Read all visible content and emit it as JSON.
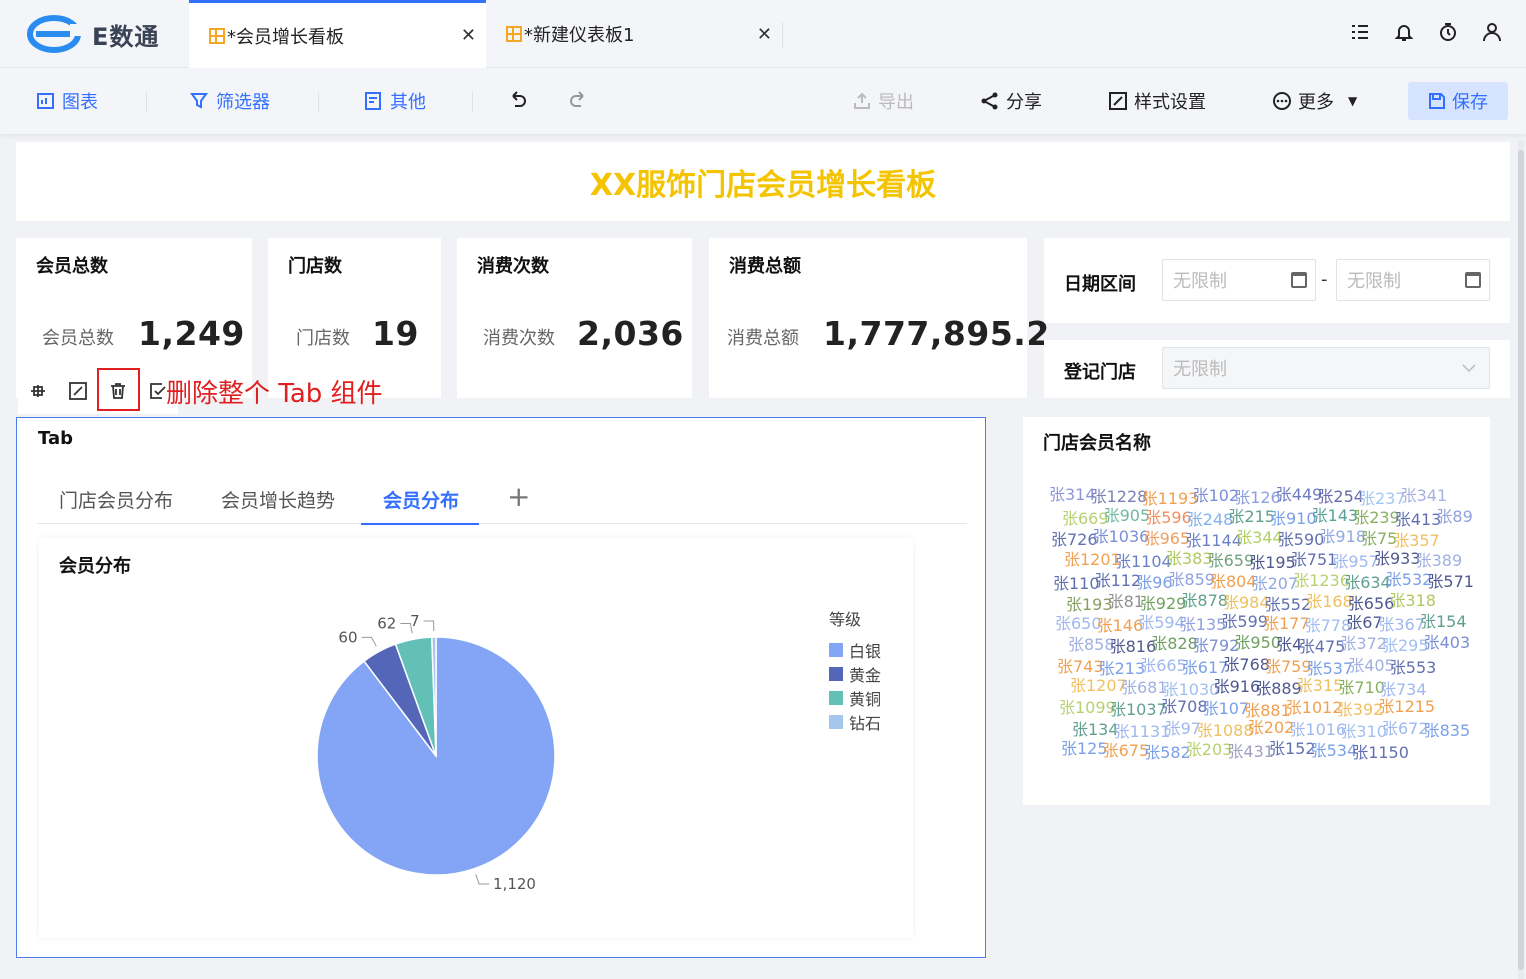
{
  "app": {
    "logo_text": "E数通"
  },
  "tabs": [
    {
      "label": "*会员增长看板",
      "active": true
    },
    {
      "label": "*新建仪表板1",
      "active": false
    }
  ],
  "toolbar": {
    "chart": "图表",
    "filter": "筛选器",
    "other": "其他",
    "export": "导出",
    "share": "分享",
    "style": "样式设置",
    "more": "更多",
    "save": "保存"
  },
  "dashboard_title": "XX服饰门店会员增长看板",
  "kpis": [
    {
      "title": "会员总数",
      "label": "会员总数",
      "value": "1,249"
    },
    {
      "title": "门店数",
      "label": "门店数",
      "value": "19"
    },
    {
      "title": "消费次数",
      "label": "消费次数",
      "value": "2,036"
    },
    {
      "title": "消费总额",
      "label": "消费总额",
      "value": "1,777,895.2"
    }
  ],
  "filters": {
    "date_label": "日期区间",
    "date_start_placeholder": "无限制",
    "date_sep": "-",
    "date_end_placeholder": "无限制",
    "store_label": "登记门店",
    "store_placeholder": "无限制"
  },
  "annotation": "删除整个 Tab 组件",
  "tab_component": {
    "title": "Tab",
    "tabs": [
      "门店会员分布",
      "会员增长趋势",
      "会员分布"
    ],
    "active_tab": "会员分布",
    "add": "+"
  },
  "chart_data": {
    "type": "pie",
    "title": "会员分布",
    "legend_title": "等级",
    "categories": [
      "白银",
      "黄金",
      "黄铜",
      "钻石"
    ],
    "values": [
      1120,
      60,
      62,
      7
    ],
    "labels": [
      "1,120",
      "60",
      "62",
      "7"
    ],
    "colors": [
      "#84a5f6",
      "#5466b8",
      "#62c0b6",
      "#a4c6ea"
    ]
  },
  "word_cloud": {
    "title": "门店会员名称",
    "words": [
      [
        "张314",
        "#8f97d8"
      ],
      [
        "张1228",
        "#7a7fb8"
      ],
      [
        "张1193",
        "#f0a050"
      ],
      [
        "张102",
        "#7a8fd6"
      ],
      [
        "张126",
        "#8ca0e0"
      ],
      [
        "张449",
        "#6b7cc4"
      ],
      [
        "张254",
        "#6a6ab0"
      ],
      [
        "张237",
        "#a0c8f0"
      ],
      [
        "张341",
        "#a4b0e0"
      ],
      [
        "张669",
        "#b8d070"
      ],
      [
        "张905",
        "#70b8a0"
      ],
      [
        "张596",
        "#f09060"
      ],
      [
        "张248",
        "#7fb0f0"
      ],
      [
        "张215",
        "#60a090"
      ],
      [
        "张910",
        "#7aa0e8"
      ],
      [
        "张143",
        "#5aa098"
      ],
      [
        "张239",
        "#88b060"
      ],
      [
        "张413",
        "#6070b0"
      ],
      [
        "张89",
        "#90a0e0"
      ],
      [
        "张726",
        "#6070b0"
      ],
      [
        "张1036",
        "#7a8fd6"
      ],
      [
        "张965",
        "#f0a060"
      ],
      [
        "张1144",
        "#6a80c8"
      ],
      [
        "张344",
        "#b0d060"
      ],
      [
        "张590",
        "#6070b0"
      ],
      [
        "张918",
        "#90a8e0"
      ],
      [
        "张75",
        "#88b060"
      ],
      [
        "张357",
        "#f0c060"
      ],
      [
        "张1201",
        "#f0a050"
      ],
      [
        "张1104",
        "#6a80c8"
      ],
      [
        "张383",
        "#b0c860"
      ],
      [
        "张659",
        "#70a080"
      ],
      [
        "张195",
        "#505890"
      ],
      [
        "张751",
        "#6070b0"
      ],
      [
        "张957",
        "#a0b8f0"
      ],
      [
        "张933",
        "#505890"
      ],
      [
        "张389",
        "#a0b0e0"
      ],
      [
        "张110",
        "#6070b0"
      ],
      [
        "张112",
        "#6070b0"
      ],
      [
        "张96",
        "#7aa0e8"
      ],
      [
        "张859",
        "#90a0e0"
      ],
      [
        "张804",
        "#f0a050"
      ],
      [
        "张207",
        "#90a8e0"
      ],
      [
        "张1236",
        "#b8d070"
      ],
      [
        "张634",
        "#60a090"
      ],
      [
        "张532",
        "#7aa0e8"
      ],
      [
        "张571",
        "#505890"
      ],
      [
        "张193",
        "#88a060"
      ],
      [
        "张81",
        "#909090"
      ],
      [
        "张929",
        "#70a060"
      ],
      [
        "张878",
        "#60a090"
      ],
      [
        "张984",
        "#f0c060"
      ],
      [
        "张552",
        "#6070b0"
      ],
      [
        "张168",
        "#f0c060"
      ],
      [
        "张656",
        "#505890"
      ],
      [
        "张318",
        "#b0c860"
      ],
      [
        "张650",
        "#a0b8f0"
      ],
      [
        "张146",
        "#f0a050"
      ],
      [
        "张594",
        "#a0b8f0"
      ],
      [
        "张135",
        "#90a0e0"
      ],
      [
        "张599",
        "#6070b0"
      ],
      [
        "张177",
        "#f0a050"
      ],
      [
        "张778",
        "#a0c0f0"
      ],
      [
        "张67",
        "#505890"
      ],
      [
        "张367",
        "#a0b8f0"
      ],
      [
        "张154",
        "#60a090"
      ],
      [
        "张858",
        "#a0b0e0"
      ],
      [
        "张816",
        "#505890"
      ],
      [
        "张828",
        "#70a060"
      ],
      [
        "张792",
        "#7a8fd6"
      ],
      [
        "张950",
        "#70a060"
      ],
      [
        "张4",
        "#505890"
      ],
      [
        "张475",
        "#6070b0"
      ],
      [
        "张372",
        "#a0b0e0"
      ],
      [
        "张295",
        "#a0c0f0"
      ],
      [
        "张403",
        "#7a8fd6"
      ],
      [
        "张743",
        "#f0a050"
      ],
      [
        "张213",
        "#7aa0e8"
      ],
      [
        "张665",
        "#a0b8f0"
      ],
      [
        "张617",
        "#7aa0e8"
      ],
      [
        "张768",
        "#505890"
      ],
      [
        "张759",
        "#f0a050"
      ],
      [
        "张537",
        "#7aa0e8"
      ],
      [
        "张405",
        "#a0b0e0"
      ],
      [
        "张553",
        "#6070b0"
      ],
      [
        "张1207",
        "#f0c060"
      ],
      [
        "张681",
        "#a0b0e0"
      ],
      [
        "张1030",
        "#a0c0f0"
      ],
      [
        "张916",
        "#505890"
      ],
      [
        "张889",
        "#505890"
      ],
      [
        "张315",
        "#f0c060"
      ],
      [
        "张710",
        "#88b060"
      ],
      [
        "张734",
        "#a0b8f0"
      ],
      [
        "张1099",
        "#b8d070"
      ],
      [
        "张1037",
        "#60a090"
      ],
      [
        "张708",
        "#6070b0"
      ],
      [
        "张107",
        "#7aa0e8"
      ],
      [
        "张881",
        "#f0a050"
      ],
      [
        "张1012",
        "#f0a050"
      ],
      [
        "张392",
        "#f0c060"
      ],
      [
        "张1215",
        "#f0a050"
      ],
      [
        "张134",
        "#60a090"
      ],
      [
        "张1131",
        "#a0b8f0"
      ],
      [
        "张97",
        "#a0b8f0"
      ],
      [
        "张1088",
        "#f0c060"
      ],
      [
        "张202",
        "#f0a050"
      ],
      [
        "张1016",
        "#a0b8f0"
      ],
      [
        "张310",
        "#a0c0f0"
      ],
      [
        "张672",
        "#a0b8f0"
      ],
      [
        "张835",
        "#7aa0e8"
      ],
      [
        "张125",
        "#7aa0e8"
      ],
      [
        "张675",
        "#f0a050"
      ],
      [
        "张582",
        "#7aa0e8"
      ],
      [
        "张203",
        "#b8d070"
      ],
      [
        "张431",
        "#a0a0c0"
      ],
      [
        "张152",
        "#6070b0"
      ],
      [
        "张534",
        "#7aa0e8"
      ],
      [
        "张1150",
        "#6070b0"
      ]
    ]
  }
}
